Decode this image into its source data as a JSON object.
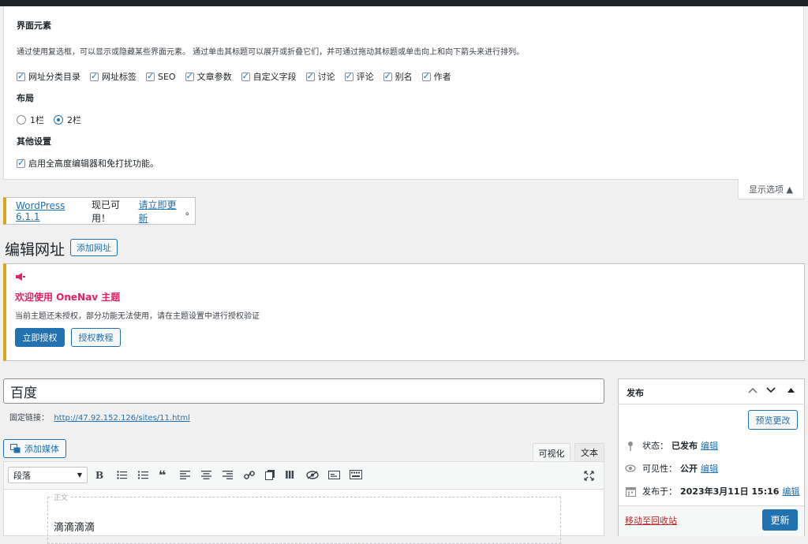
{
  "screen_options": {
    "section_elements_title": "界面元素",
    "section_elements_desc": "通过使用复选框，可以显示或隐藏某些界面元素。 通过单击其标题可以展开或折叠它们，并可通过拖动其标题或单击向上和向下箭头来进行排列。",
    "checkboxes": [
      {
        "label": "网址分类目录",
        "checked": true
      },
      {
        "label": "网址标签",
        "checked": true
      },
      {
        "label": "SEO",
        "checked": true
      },
      {
        "label": "文章参数",
        "checked": true
      },
      {
        "label": "自定义字段",
        "checked": true
      },
      {
        "label": "讨论",
        "checked": true
      },
      {
        "label": "评论",
        "checked": true
      },
      {
        "label": "别名",
        "checked": true
      },
      {
        "label": "作者",
        "checked": true
      }
    ],
    "layout_title": "布局",
    "layout_options": [
      {
        "label": "1栏",
        "checked": false
      },
      {
        "label": "2栏",
        "checked": true
      }
    ],
    "other_title": "其他设置",
    "other_option": {
      "label": "启用全高度编辑器和免打扰功能。",
      "checked": true
    },
    "tab_label": "显示选项 ▲"
  },
  "update_nag": {
    "link_text": "WordPress 6.1.1",
    "middle_text": "现已可用！",
    "update_link": "请立即更新",
    "end_text": "。"
  },
  "page": {
    "title": "编辑网址",
    "add_button": "添加网址"
  },
  "notice": {
    "title": "欢迎使用 OneNav 主题",
    "desc": "当前主题还未授权，部分功能无法使用，请在主题设置中进行授权验证",
    "primary_button": "立即授权",
    "secondary_button": "授权教程"
  },
  "post": {
    "title": "百度",
    "permalink_label": "固定链接：",
    "permalink_url": "http://47.92.152.126/sites/11.html",
    "add_media": "添加媒体",
    "tab_visual": "可视化",
    "tab_text": "文本",
    "format_select": "段落",
    "content_placeholder": "正文",
    "content_text": "滴滴滴滴"
  },
  "publish": {
    "title": "发布",
    "preview_button": "预览更改",
    "status_label": "状态：",
    "status_value": "已发布",
    "visibility_label": "可见性：",
    "visibility_value": "公开",
    "published_label": "发布于：",
    "published_value": "2023年3月11日 15:16",
    "edit_link": "编辑",
    "trash_link": "移动至回收站",
    "update_button": "更新"
  }
}
